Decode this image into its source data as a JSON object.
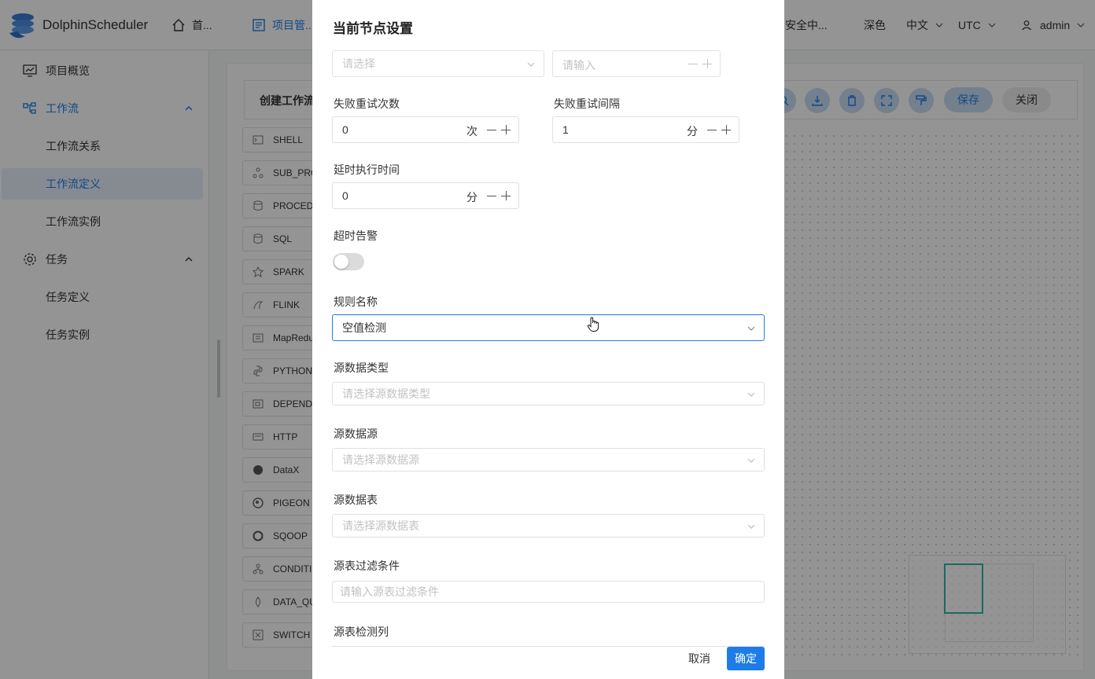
{
  "app": {
    "brand": "DolphinScheduler",
    "nav": [
      "首...",
      "项目管...",
      "安全中..."
    ],
    "theme": "深色",
    "language": "中文",
    "timezone": "UTC",
    "user": "admin"
  },
  "sidebar": {
    "items": [
      {
        "label": "项目概览",
        "icon": "monitor-chart-icon"
      },
      {
        "label": "工作流",
        "icon": "workflow-icon"
      },
      {
        "label": "工作流关系"
      },
      {
        "label": "工作流定义"
      },
      {
        "label": "工作流实例"
      },
      {
        "label": "任务",
        "icon": "gear-icon"
      },
      {
        "label": "任务定义"
      },
      {
        "label": "任务实例"
      }
    ]
  },
  "workflow": {
    "title": "创建工作流",
    "tasks": [
      "SHELL",
      "SUB_PROCESS",
      "PROCEDURE",
      "SQL",
      "SPARK",
      "FLINK",
      "MapReduce",
      "PYTHON",
      "DEPENDENT",
      "HTTP",
      "DataX",
      "PIGEON",
      "SQOOP",
      "CONDITIONS",
      "DATA_QUALITY",
      "SWITCH"
    ],
    "save_label": "保存",
    "close_label": "关闭"
  },
  "drawer": {
    "title": "当前节点设置",
    "top_select_placeholder": "请选择",
    "top_number_placeholder": "请输入",
    "retry_times": {
      "label": "失败重试次数",
      "value": "0",
      "unit": "次"
    },
    "retry_interval": {
      "label": "失败重试间隔",
      "value": "1",
      "unit": "分"
    },
    "delay_time": {
      "label": "延时执行时间",
      "value": "0",
      "unit": "分"
    },
    "timeout_alarm": {
      "label": "超时告警",
      "enabled": false
    },
    "rule_name": {
      "label": "规则名称",
      "value": "空值检测"
    },
    "src_type": {
      "label": "源数据类型",
      "placeholder": "请选择源数据类型"
    },
    "src_datasource": {
      "label": "源数据源",
      "placeholder": "请选择源数据源"
    },
    "src_table": {
      "label": "源数据表",
      "placeholder": "请选择源数据表"
    },
    "src_filter": {
      "label": "源表过滤条件",
      "placeholder": "请输入源表过滤条件"
    },
    "src_column": {
      "label": "源表检测列"
    },
    "cancel_label": "取消",
    "confirm_label": "确定"
  },
  "colors": {
    "accent": "#1e7ce8",
    "overlay": "rgba(0,0,0,0.42)",
    "minimap": "#33b5a5"
  }
}
